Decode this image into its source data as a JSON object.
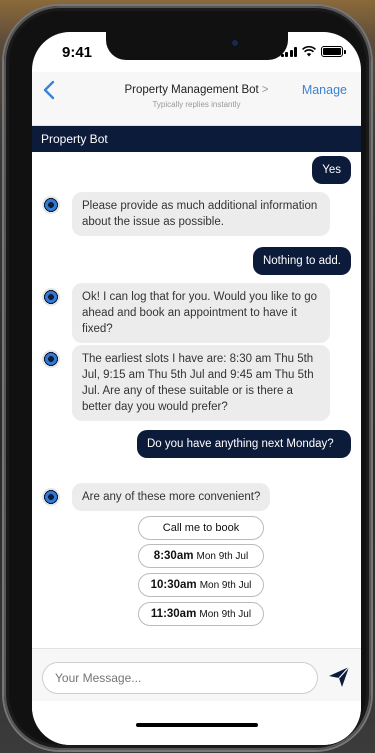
{
  "status": {
    "time": "9:41"
  },
  "nav": {
    "title": "Property Management Bot",
    "subtitle": "Typically replies instantly",
    "manage_label": "Manage"
  },
  "bot_header": "Property Bot",
  "messages": [
    {
      "from": "user",
      "text": "Yes"
    },
    {
      "from": "bot",
      "text": "Please provide as much additional information about the issue as possible."
    },
    {
      "from": "user",
      "text": "Nothing to add."
    },
    {
      "from": "bot",
      "text": "Ok! I can log that for you. Would you like to go ahead and book an appointment to have it fixed?"
    },
    {
      "from": "bot",
      "text": "The earliest slots I have are: 8:30 am Thu 5th Jul, 9:15 am Thu 5th Jul and 9:45 am Thu 5th Jul. Are any of these suitable or is there a better day you would prefer?"
    },
    {
      "from": "user",
      "text": "Do you have anything next Monday?"
    },
    {
      "from": "bot",
      "text": "Are any of these more convenient?"
    }
  ],
  "quick_replies": [
    {
      "label": "Call me to book"
    },
    {
      "time": "8:30am",
      "date": "Mon 9th Jul"
    },
    {
      "time": "10:30am",
      "date": "Mon 9th Jul"
    },
    {
      "time": "11:30am",
      "date": "Mon 9th Jul"
    }
  ],
  "composer": {
    "placeholder": "Your Message..."
  },
  "colors": {
    "accent": "#3b82d6",
    "bot_header_bg": "#0d1b3a",
    "user_bubble": "#0d1b3a",
    "bot_bubble": "#ececec"
  },
  "icons": {
    "back": "chevron-left-icon",
    "send": "paper-plane-icon",
    "avatar": "bot-eye-icon"
  }
}
